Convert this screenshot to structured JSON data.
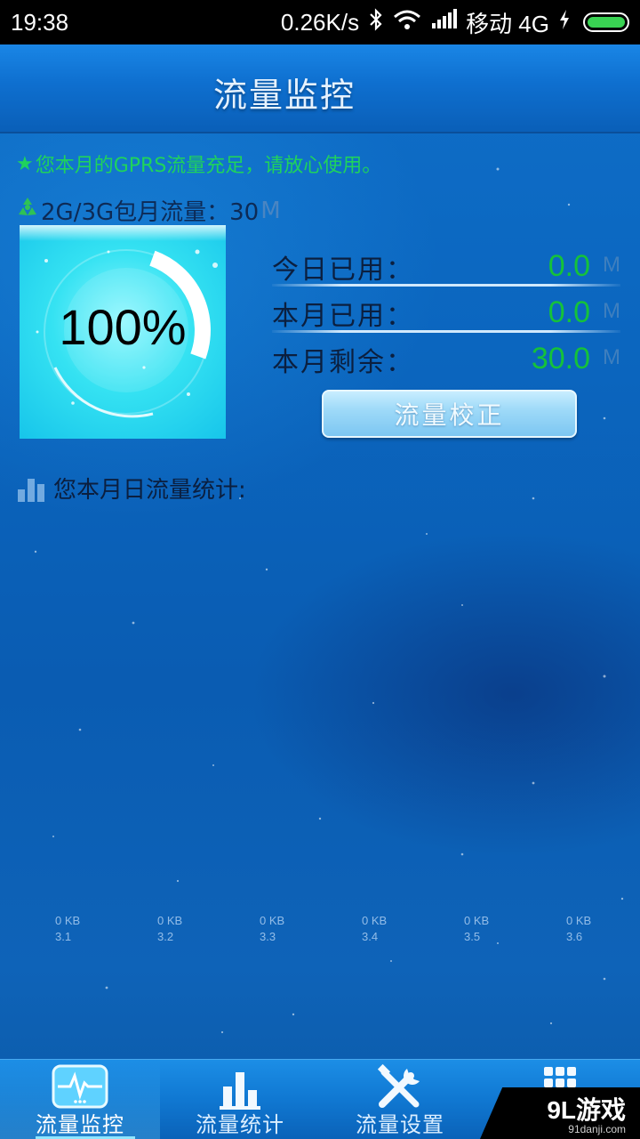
{
  "status_bar": {
    "time": "19:38",
    "speed": "0.26K/s",
    "carrier": "移动 4G"
  },
  "header": {
    "title": "流量监控"
  },
  "notice": {
    "text": "您本月的GPRS流量充足，请放心使用。"
  },
  "quota": {
    "label": "2G/3G包月流量：30",
    "unit": "M"
  },
  "gauge": {
    "percent_text": "100%",
    "remaining_fraction": 1.0
  },
  "stats": [
    {
      "label": "今日已用：",
      "value": "0.0",
      "unit": "M"
    },
    {
      "label": "本月已用：",
      "value": "0.0",
      "unit": "M"
    },
    {
      "label": "本月剩余：",
      "value": "30.0",
      "unit": "M"
    }
  ],
  "calibrate_button": {
    "label": "流量校正"
  },
  "daily_stats": {
    "heading": "您本月日流量统计:",
    "days": [
      {
        "value": "0 KB",
        "date": "3.1"
      },
      {
        "value": "0 KB",
        "date": "3.2"
      },
      {
        "value": "0 KB",
        "date": "3.3"
      },
      {
        "value": "0 KB",
        "date": "3.4"
      },
      {
        "value": "0 KB",
        "date": "3.5"
      },
      {
        "value": "0 KB",
        "date": "3.6"
      }
    ]
  },
  "tabs": [
    {
      "label": "流量监控",
      "icon": "monitor-pulse-icon",
      "active": true
    },
    {
      "label": "流量统计",
      "icon": "bar-chart-icon",
      "active": false
    },
    {
      "label": "流量设置",
      "icon": "wrench-screwdriver-icon",
      "active": false
    },
    {
      "label": "",
      "icon": "grid-menu-icon",
      "active": false
    }
  ],
  "watermark": {
    "brand": "9L游戏",
    "site": "91danji.com"
  },
  "colors": {
    "accent_green": "#15c23a",
    "notice_green": "#1fd35c",
    "background_blue": "#0a5cb0"
  }
}
